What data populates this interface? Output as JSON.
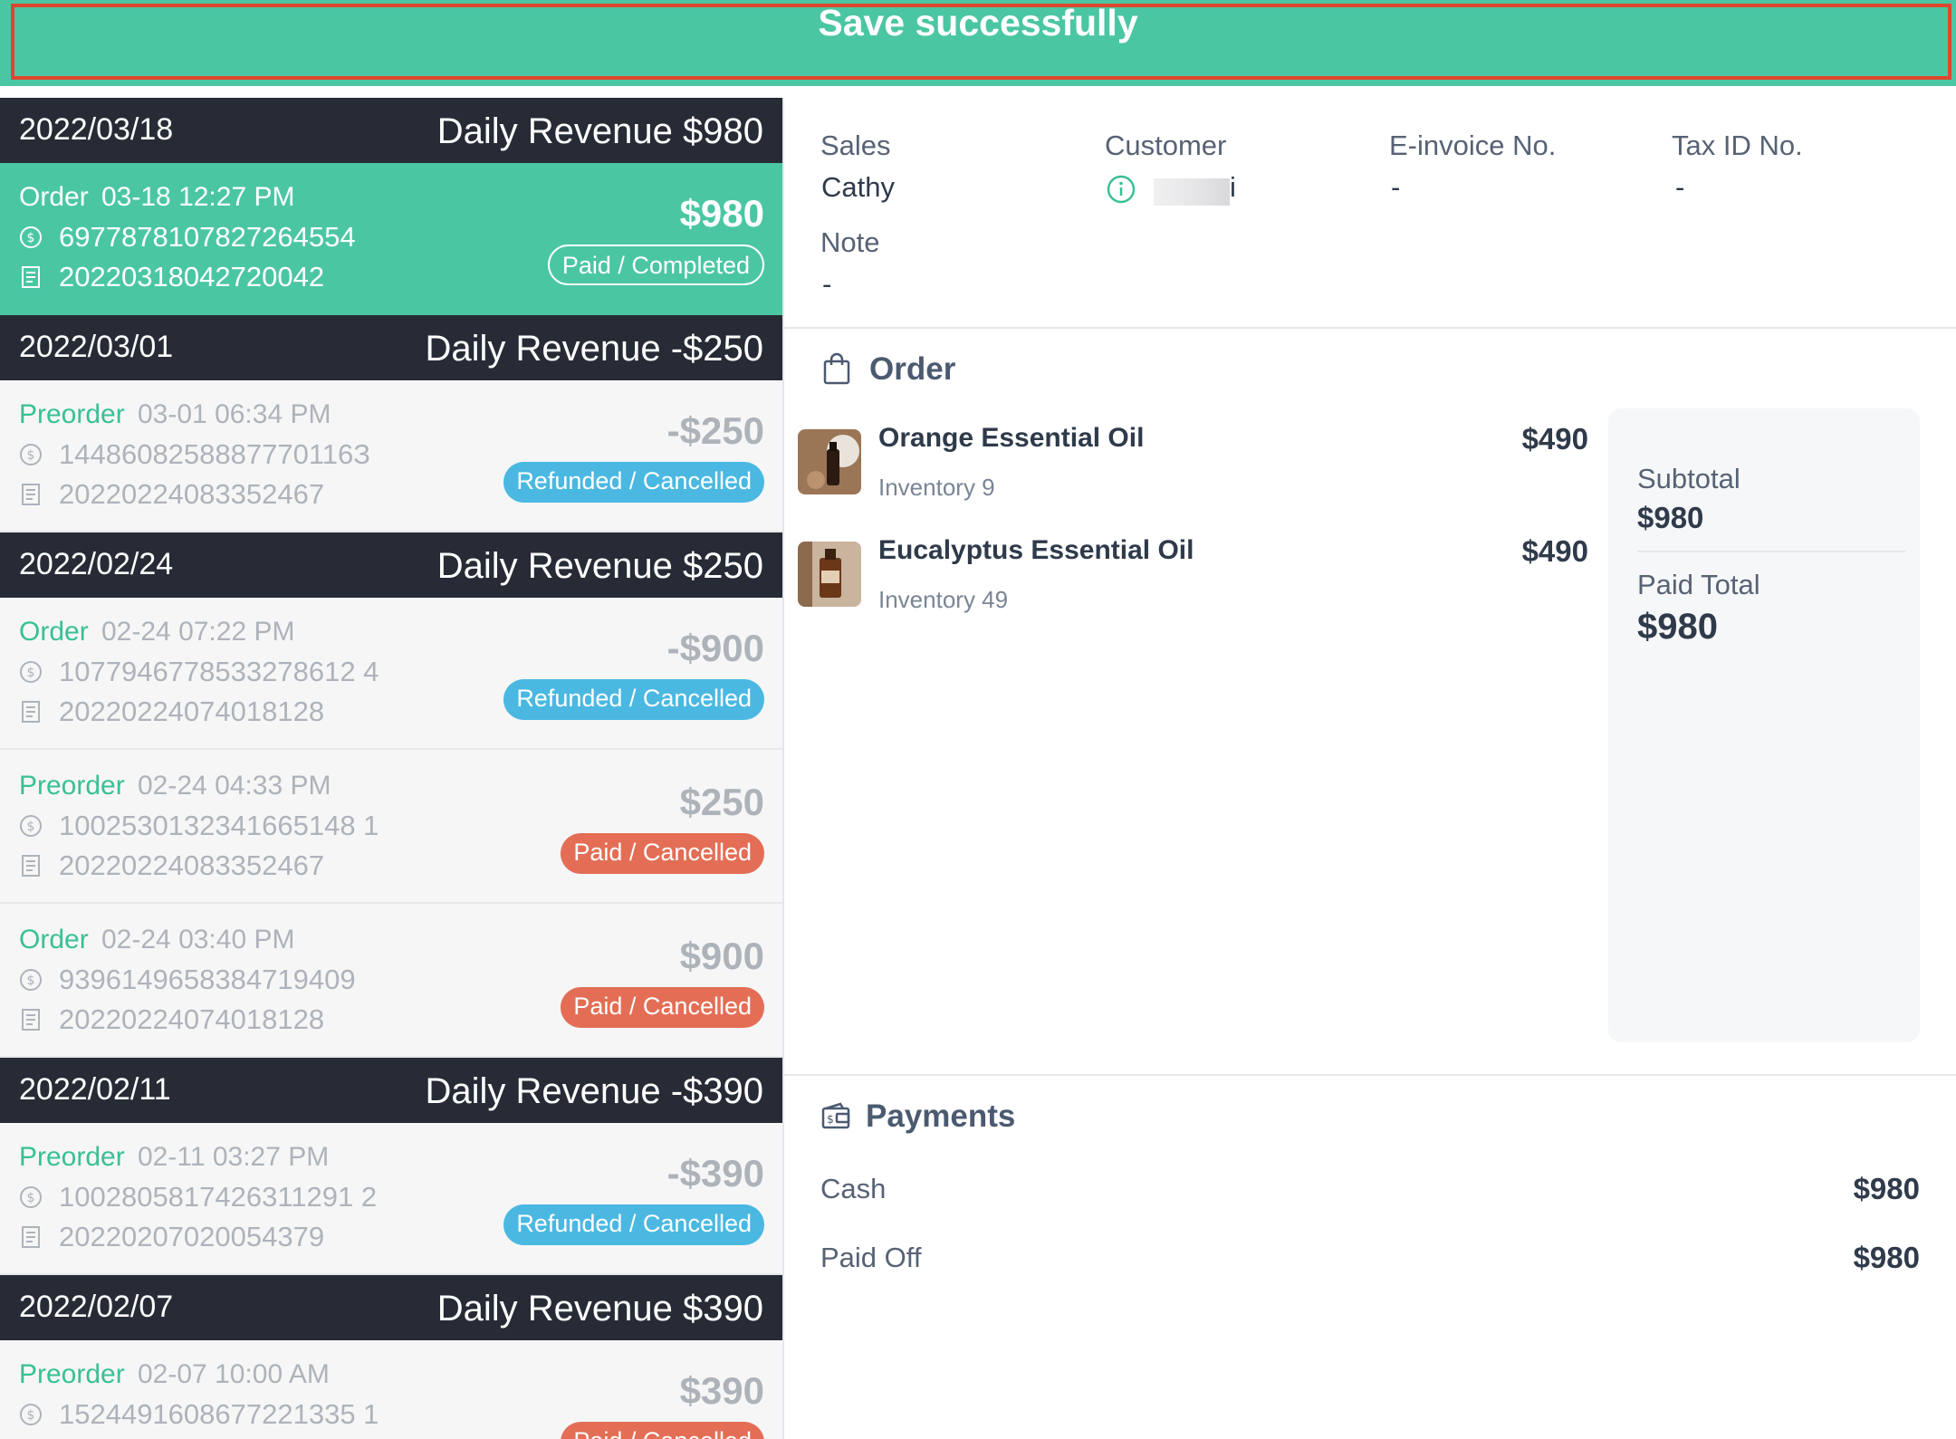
{
  "toast": {
    "message": "Save successfully"
  },
  "days": [
    {
      "date": "2022/03/18",
      "revenue": "Daily Revenue $980"
    },
    {
      "date": "2022/03/01",
      "revenue": "Daily Revenue -$250"
    },
    {
      "date": "2022/02/24",
      "revenue": "Daily Revenue $250"
    },
    {
      "date": "2022/02/11",
      "revenue": "Daily Revenue -$390"
    },
    {
      "date": "2022/02/07",
      "revenue": "Daily Revenue $390"
    }
  ],
  "orders": [
    {
      "type": "Order",
      "time": "03-18 12:27 PM",
      "payment_no": "6977878107827264554",
      "receipt_no": "20220318042720042",
      "amount": "$980",
      "status": "Paid / Completed"
    },
    {
      "type": "Preorder",
      "time": "03-01 06:34 PM",
      "payment_no": "1448608258887770116З",
      "receipt_no": "20220224083352467",
      "amount": "-$250",
      "status": "Refunded / Cancelled"
    },
    {
      "type": "Order",
      "time": "02-24 07:22 PM",
      "payment_no": "1077946778533278612 4",
      "receipt_no": "20220224074018128",
      "amount": "-$900",
      "status": "Refunded / Cancelled"
    },
    {
      "type": "Preorder",
      "time": "02-24 04:33 PM",
      "payment_no": "1002530132341665148 1",
      "receipt_no": "20220224083352467",
      "amount": "$250",
      "status": "Paid / Cancelled"
    },
    {
      "type": "Order",
      "time": "02-24 03:40 PM",
      "payment_no": "9396149658384719409",
      "receipt_no": "20220224074018128",
      "amount": "$900",
      "status": "Paid / Cancelled"
    },
    {
      "type": "Preorder",
      "time": "02-11 03:27 PM",
      "payment_no": "1002805817426311291 2",
      "receipt_no": "20220207020054379",
      "amount": "-$390",
      "status": "Refunded / Cancelled"
    },
    {
      "type": "Preorder",
      "time": "02-07 10:00 AM",
      "payment_no": "1524491608677221335 1",
      "receipt_no": "",
      "amount": "$390",
      "status": "Paid / Cancelled"
    }
  ],
  "detail": {
    "sales_label": "Sales",
    "sales_value": "Cathy",
    "customer_label": "Customer",
    "customer_value": "i",
    "einvoice_label": "E-invoice No.",
    "einvoice_value": "-",
    "taxid_label": "Tax ID No.",
    "taxid_value": "-",
    "note_label": "Note",
    "note_value": "-"
  },
  "order_section": {
    "title": "Order",
    "items": [
      {
        "name": "Orange Essential Oil",
        "inventory": "Inventory 9",
        "price": "$490"
      },
      {
        "name": "Eucalyptus Essential Oil",
        "inventory": "Inventory 49",
        "price": "$490"
      }
    ],
    "subtotal_label": "Subtotal",
    "subtotal_value": "$980",
    "paid_total_label": "Paid Total",
    "paid_total_value": "$980"
  },
  "payments": {
    "title": "Payments",
    "rows": [
      {
        "label": "Cash",
        "amount": "$980"
      },
      {
        "label": "Paid Off",
        "amount": "$980"
      }
    ]
  },
  "colors": {
    "accent": "#4bc6a3",
    "dark_header": "#262b35",
    "refund": "#4bb8e2",
    "cancel": "#e36e55",
    "alert_border": "#e0462d"
  }
}
